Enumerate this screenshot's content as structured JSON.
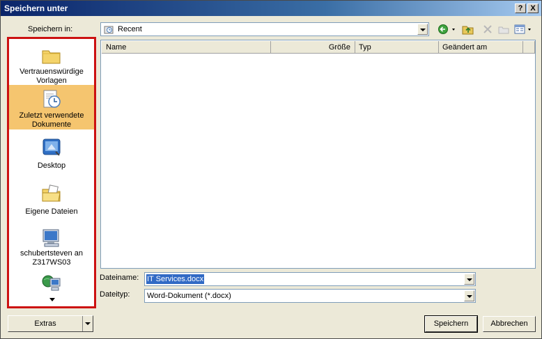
{
  "window": {
    "title": "Speichern unter"
  },
  "caption_buttons": {
    "help": "?",
    "close": "X"
  },
  "location": {
    "label": "Speichern in:",
    "value": "Recent"
  },
  "places": [
    {
      "label": "Vertrauenswürdige Vorlagen",
      "icon": "folder-icon",
      "selected": false
    },
    {
      "label": "Zuletzt verwendete Dokumente",
      "icon": "recent-documents-icon",
      "selected": true
    },
    {
      "label": "Desktop",
      "icon": "desktop-icon",
      "selected": false
    },
    {
      "label": "Eigene Dateien",
      "icon": "my-documents-icon",
      "selected": false
    },
    {
      "label": "schubertsteven an Z317WS03",
      "icon": "my-computer-icon",
      "selected": false
    },
    {
      "label": "",
      "icon": "network-places-icon",
      "selected": false
    }
  ],
  "file_list": {
    "columns": [
      "Name",
      "Größe",
      "Typ",
      "Geändert am"
    ],
    "rows": []
  },
  "filename": {
    "label": "Dateiname:",
    "value": "IT Services.docx"
  },
  "filetype": {
    "label": "Dateityp:",
    "value": "Word-Dokument (*.docx)"
  },
  "buttons": {
    "tools": "Extras",
    "save": "Speichern",
    "cancel": "Abbrechen"
  },
  "colors": {
    "highlight": "#cc1111",
    "selected_place": "#f5c56f",
    "title_bar": "#0a246a"
  }
}
